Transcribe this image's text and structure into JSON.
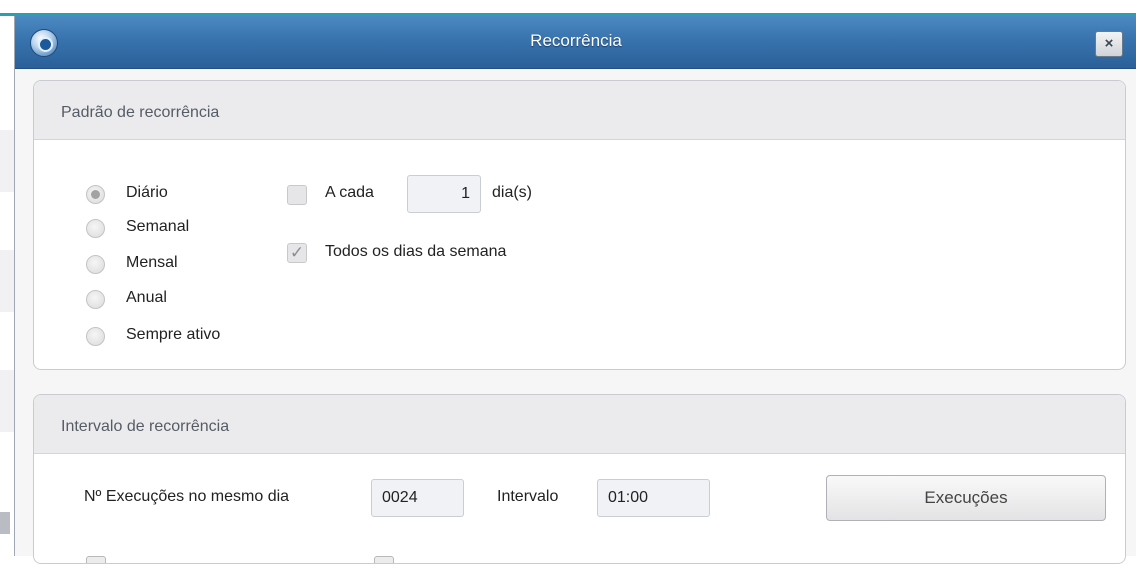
{
  "window": {
    "title": "Recorrência",
    "close_glyph": "×",
    "icon": "app-globe-icon"
  },
  "pattern_group": {
    "title": "Padrão de recorrência",
    "options": [
      {
        "label": "Diário",
        "checked": true
      },
      {
        "label": "Semanal",
        "checked": false
      },
      {
        "label": "Mensal",
        "checked": false
      },
      {
        "label": "Anual",
        "checked": false
      },
      {
        "label": "Sempre ativo",
        "checked": false
      }
    ],
    "every_label": "A cada",
    "every_checked": false,
    "every_value": "1",
    "every_unit": "dia(s)",
    "all_days_label": "Todos os dias da semana",
    "all_days_checked": true,
    "checkmark_glyph": "✓"
  },
  "interval_group": {
    "title": "Intervalo de recorrência",
    "executions_label": "Nº Execuções no mesmo dia",
    "executions_value": "0024",
    "interval_label": "Intervalo",
    "interval_value": "01:00",
    "executions_button": "Execuções"
  }
}
